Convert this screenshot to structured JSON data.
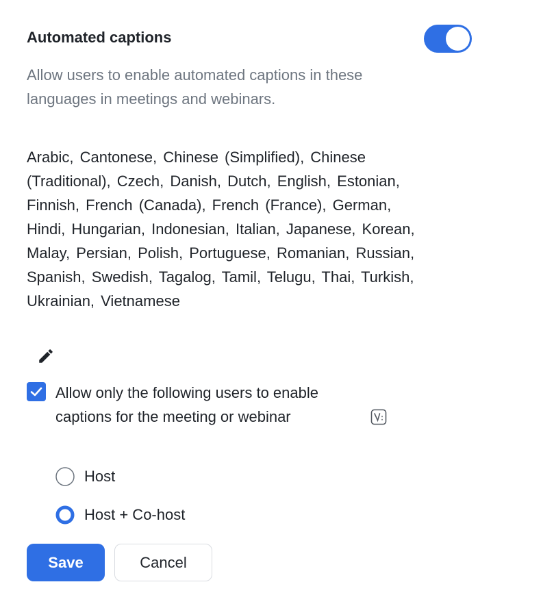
{
  "setting": {
    "title": "Automated captions",
    "toggle_on": true,
    "description": "Allow users to enable automated captions in these languages in meetings and webinars.",
    "languages": "Arabic,  Cantonese,  Chinese (Simplified),  Chinese (Traditional),  Czech,  Danish,  Dutch,  English,  Estonian,  Finnish,  French (Canada),  French (France),  German,  Hindi,  Hungarian,  Indonesian,  Italian,  Japanese,  Korean,  Malay,  Persian,  Polish,  Portuguese,  Romanian,  Russian,  Spanish,  Swedish,  Tagalog,  Tamil,  Telugu,  Thai,  Turkish,  Ukrainian,  Vietnamese",
    "edit_icon": "pencil-icon"
  },
  "restriction": {
    "checked": true,
    "label": "Allow only the following users to enable captions for the meeting or webinar",
    "info_icon": "info-icon",
    "options": [
      {
        "label": "Host",
        "selected": false
      },
      {
        "label": "Host + Co-host",
        "selected": true
      }
    ]
  },
  "actions": {
    "save_label": "Save",
    "cancel_label": "Cancel"
  },
  "colors": {
    "accent": "#2f6fe4",
    "text": "#1f2329",
    "muted": "#6e7680"
  }
}
